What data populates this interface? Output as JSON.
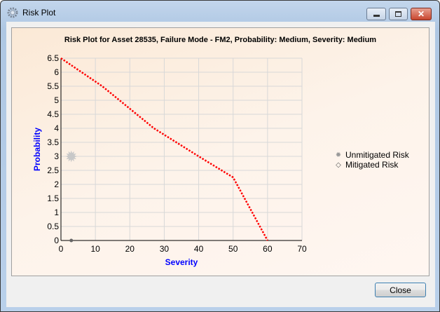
{
  "window": {
    "title": "Risk Plot",
    "minimize_icon": "minimize-icon",
    "maximize_icon": "maximize-icon",
    "close_icon": "close-icon"
  },
  "chart_data": {
    "type": "line",
    "title": "Risk Plot for Asset 28535, Failure Mode  - FM2, Probability: Medium, Severity: Medium",
    "xlabel": "Severity",
    "ylabel": "Probability",
    "xlim": [
      0,
      70
    ],
    "ylim": [
      0,
      6.5
    ],
    "xticks": [
      "0",
      "10",
      "20",
      "30",
      "40",
      "50",
      "60",
      "70"
    ],
    "yticks": [
      "0",
      "0.5",
      "1",
      "1.5",
      "2",
      "2.5",
      "3",
      "3.5",
      "4",
      "4.5",
      "5",
      "5.5",
      "6",
      "6.5"
    ],
    "grid": true,
    "legend_position": "right",
    "risk_curve": {
      "color": "#ff0000",
      "style": "dotted",
      "x": [
        0,
        12,
        27,
        40,
        50,
        60
      ],
      "y": [
        6.5,
        5.5,
        4,
        3,
        2.25,
        0
      ]
    },
    "series": [
      {
        "name": "Unmitigated Risk",
        "marker": "starburst",
        "color": "#c8c8c8",
        "x": [
          3
        ],
        "y": [
          3
        ]
      },
      {
        "name": "Mitigated Risk",
        "marker": "diamond",
        "color": "#666666",
        "x": [
          3
        ],
        "y": [
          0
        ]
      }
    ]
  },
  "buttons": {
    "close": "Close"
  }
}
